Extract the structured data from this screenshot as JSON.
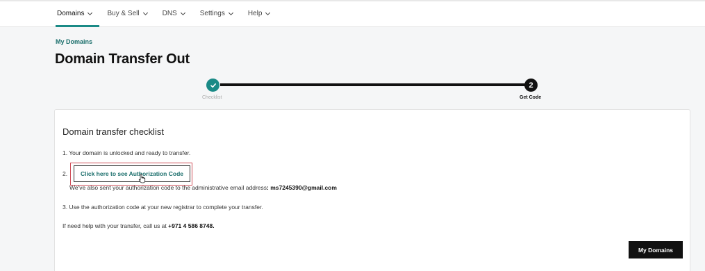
{
  "nav": {
    "items": [
      {
        "label": "Domains",
        "active": true
      },
      {
        "label": "Buy & Sell",
        "active": false
      },
      {
        "label": "DNS",
        "active": false
      },
      {
        "label": "Settings",
        "active": false
      },
      {
        "label": "Help",
        "active": false
      }
    ]
  },
  "breadcrumb": "My Domains",
  "page_title": "Domain Transfer Out",
  "stepper": {
    "steps": [
      {
        "label": "Checklist",
        "status": "complete",
        "icon": "check-icon"
      },
      {
        "label": "Get Code",
        "number": "2",
        "status": "current"
      }
    ]
  },
  "card": {
    "title": "Domain transfer checklist",
    "item1": "1. Your domain is unlocked and ready to transfer.",
    "item2_number": "2.",
    "auth_button_label": "Click here to see Authorization Code",
    "email_text": "We've also sent your authorization code to the administrative email address",
    "email_sep": ": ",
    "email_address": "ms7245390@gmail.com",
    "item3": "3. Use the authorization code at your new registrar to complete your transfer.",
    "help_text": "If need help with your transfer, call us at ",
    "help_phone": "+971 4 586 8748.",
    "my_domains_button": "My Domains"
  },
  "colors": {
    "accent": "#1a8a86",
    "link": "#1a6e6b",
    "highlight_outline": "#d0505a",
    "dark": "#111111"
  }
}
